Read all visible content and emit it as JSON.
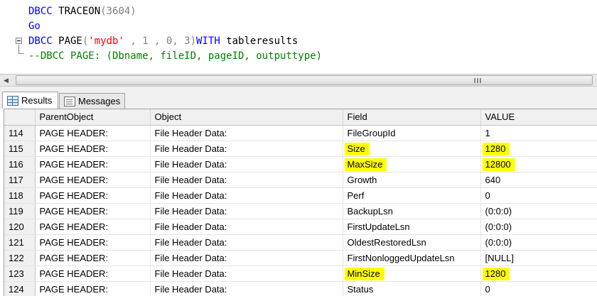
{
  "editor": {
    "line1": {
      "keyword": "DBCC",
      "plain": " TRACEON",
      "args": "(3604)"
    },
    "line2": {
      "keyword": "Go"
    },
    "line3": {
      "keyword": "DBCC",
      "plain": " PAGE",
      "open": "(",
      "string": "'mydb'",
      "args": " , 1 , 0, 3)",
      "with_kw": "WITH",
      "tail": " tableresults"
    },
    "line4": {
      "comment": "--DBCC PAGE: (Dbname, fileID, pageID, outputtype)"
    }
  },
  "tabs": [
    {
      "label": "Results",
      "icon": "grid-icon",
      "active": true
    },
    {
      "label": "Messages",
      "icon": "messages-icon",
      "active": false
    }
  ],
  "grid": {
    "columns": [
      "ParentObject",
      "Object",
      "Field",
      "VALUE"
    ],
    "highlight_color": "#ffff00",
    "rows": [
      {
        "n": "114",
        "parent": "PAGE HEADER:",
        "object": "File Header Data:",
        "field": "FileGroupId",
        "value": "1",
        "hl": false
      },
      {
        "n": "115",
        "parent": "PAGE HEADER:",
        "object": "File Header Data:",
        "field": "Size",
        "value": "1280",
        "hl": true
      },
      {
        "n": "116",
        "parent": "PAGE HEADER:",
        "object": "File Header Data:",
        "field": "MaxSize",
        "value": "12800",
        "hl": true
      },
      {
        "n": "117",
        "parent": "PAGE HEADER:",
        "object": "File Header Data:",
        "field": "Growth",
        "value": "640",
        "hl": false
      },
      {
        "n": "118",
        "parent": "PAGE HEADER:",
        "object": "File Header Data:",
        "field": "Perf",
        "value": "0",
        "hl": false
      },
      {
        "n": "119",
        "parent": "PAGE HEADER:",
        "object": "File Header Data:",
        "field": "BackupLsn",
        "value": "(0:0:0)",
        "hl": false
      },
      {
        "n": "120",
        "parent": "PAGE HEADER:",
        "object": "File Header Data:",
        "field": "FirstUpdateLsn",
        "value": "(0:0:0)",
        "hl": false
      },
      {
        "n": "121",
        "parent": "PAGE HEADER:",
        "object": "File Header Data:",
        "field": "OldestRestoredLsn",
        "value": "(0:0:0)",
        "hl": false
      },
      {
        "n": "122",
        "parent": "PAGE HEADER:",
        "object": "File Header Data:",
        "field": "FirstNonloggedUpdateLsn",
        "value": "[NULL]",
        "hl": false
      },
      {
        "n": "123",
        "parent": "PAGE HEADER:",
        "object": "File Header Data:",
        "field": "MinSize",
        "value": "1280",
        "hl": true
      },
      {
        "n": "124",
        "parent": "PAGE HEADER:",
        "object": "File Header Data:",
        "field": "Status",
        "value": "0",
        "hl": false
      }
    ]
  }
}
